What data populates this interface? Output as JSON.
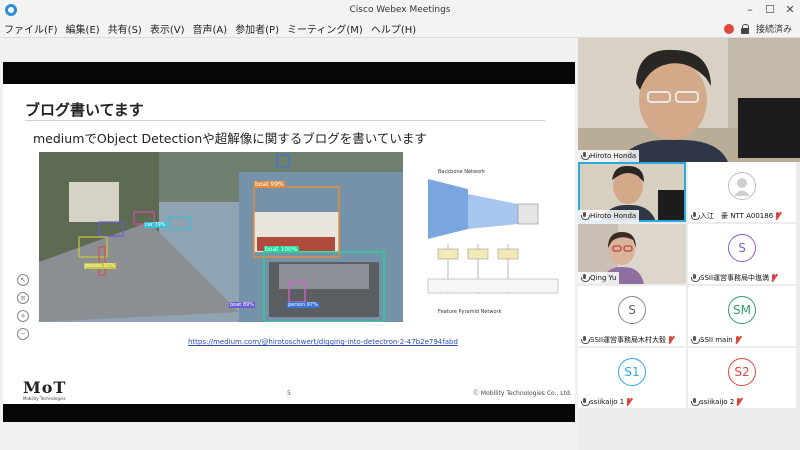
{
  "window": {
    "title": "Cisco Webex Meetings"
  },
  "menu": {
    "items": [
      "ファイル(F)",
      "編集(E)",
      "共有(S)",
      "表示(V)",
      "音声(A)",
      "参加者(P)",
      "ミーティング(M)",
      "ヘルプ(H)"
    ],
    "status": "接続済み"
  },
  "slide": {
    "title": "ブログ書いてます",
    "subtitle": "mediumでObject Detectionや超解像に関するブログを書いています",
    "link": "https://medium.com/@hirotoschwert/digging-into-detectron-2-47b2e794fabd",
    "page_number": "5",
    "copyright": "Ⓒ Mobility Technologies Co., Ltd.",
    "logo": "MoT",
    "logo_sub": "Mobility Technologies",
    "photo_labels": [
      "boat 99%",
      "boat 100%",
      "boat 89%",
      "person 97%",
      "car 79%",
      "person 91%"
    ],
    "diagram_title": "Backbone Network",
    "diagram_footer": "Feature Pyramid Network"
  },
  "participants": {
    "main": {
      "name": "Hiroto Honda"
    },
    "tiles": [
      {
        "name": "Hiroto Honda",
        "type": "video",
        "muted": false,
        "active": true
      },
      {
        "name": "入江　豪 NTT A00186",
        "type": "avatar",
        "initials": "",
        "muted": true
      },
      {
        "name": "Qing Yu",
        "type": "video",
        "muted": false
      },
      {
        "name": "SSII運営事務局中塩満",
        "type": "avatar",
        "initials": "S",
        "color": "#8a5cc4",
        "muted": true
      },
      {
        "name": "SSII運営事務局木村大毅",
        "type": "avatar",
        "initials": "S",
        "color": "#666666",
        "muted": true
      },
      {
        "name": "SSII main",
        "type": "avatar",
        "initials": "SM",
        "color": "#2e9c6a",
        "muted": true
      },
      {
        "name": "ssiikaijo 1",
        "type": "avatar",
        "initials": "S1",
        "color": "#2aa9e0",
        "muted": true
      },
      {
        "name": "ssiikaijo 2",
        "type": "avatar",
        "initials": "S2",
        "color": "#e0473c",
        "muted": true
      }
    ]
  }
}
